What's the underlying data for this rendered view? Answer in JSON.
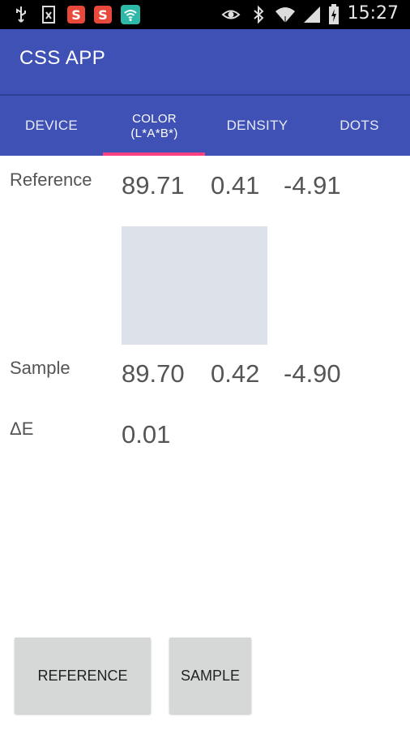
{
  "status_bar": {
    "time": "15:27",
    "icons": [
      "usb-icon",
      "nfc-icon",
      "app-s-icon",
      "app-s-icon",
      "wifi-app-icon",
      "eye-icon",
      "bluetooth-icon",
      "wifi-signal-icon",
      "cell-signal-icon",
      "battery-charging-icon"
    ],
    "colors": {
      "s_app": "#e8493a",
      "wifi_app": "#2eb8a8"
    }
  },
  "app_bar": {
    "title": "CSS APP",
    "color": "#3f51b5"
  },
  "tabs": [
    {
      "label": "DEVICE"
    },
    {
      "label": "COLOR",
      "sub": "(L*A*B*)",
      "active": true
    },
    {
      "label": "DENSITY"
    },
    {
      "label": "DOTS"
    }
  ],
  "indicator_color": "#ff4081",
  "reference": {
    "label": "Reference",
    "l": "89.71",
    "a": "0.41",
    "b": "-4.91"
  },
  "swatch_color": "#dde1ea",
  "sample": {
    "label": "Sample",
    "l": "89.70",
    "a": "0.42",
    "b": "-4.90"
  },
  "delta_e": {
    "label": "ΔE",
    "value": "0.01"
  },
  "buttons": {
    "reference": "REFERENCE",
    "sample": "SAMPLE"
  }
}
